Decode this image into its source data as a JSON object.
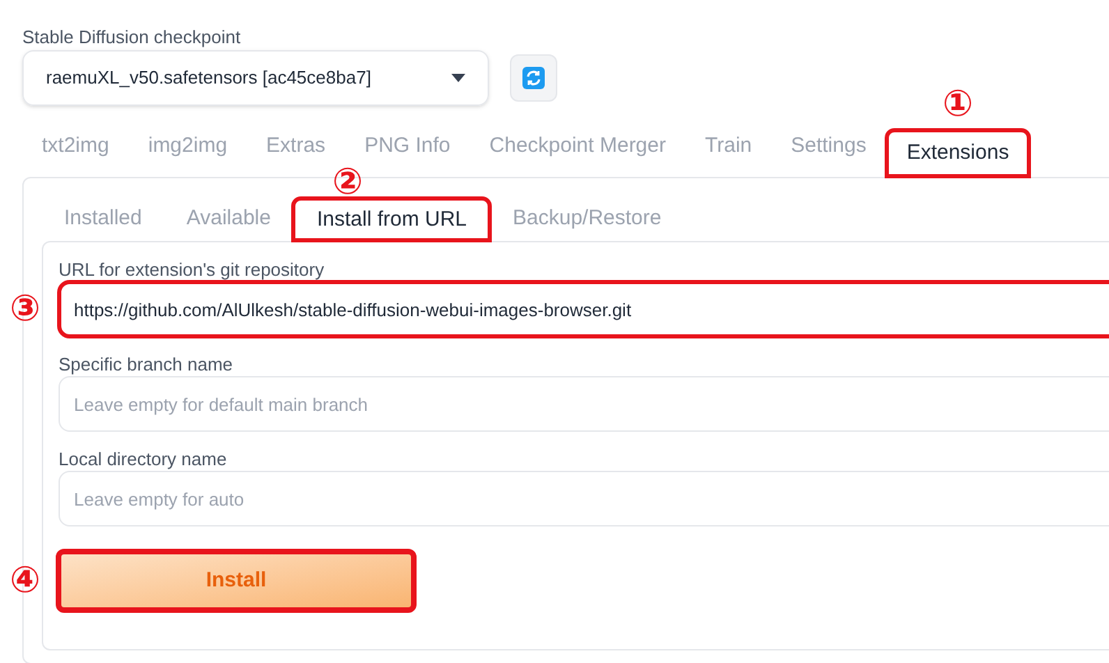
{
  "checkpoint": {
    "label": "Stable Diffusion checkpoint",
    "value": "raemuXL_v50.safetensors [ac45ce8ba7]"
  },
  "tabs": [
    {
      "label": "txt2img",
      "selected": false,
      "highlighted": false
    },
    {
      "label": "img2img",
      "selected": false,
      "highlighted": false
    },
    {
      "label": "Extras",
      "selected": false,
      "highlighted": false
    },
    {
      "label": "PNG Info",
      "selected": false,
      "highlighted": false
    },
    {
      "label": "Checkpoint Merger",
      "selected": false,
      "highlighted": false
    },
    {
      "label": "Train",
      "selected": false,
      "highlighted": false
    },
    {
      "label": "Settings",
      "selected": false,
      "highlighted": false
    },
    {
      "label": "Extensions",
      "selected": true,
      "highlighted": true,
      "marker": "①"
    }
  ],
  "subtabs": [
    {
      "label": "Installed",
      "selected": false,
      "highlighted": false
    },
    {
      "label": "Available",
      "selected": false,
      "highlighted": false
    },
    {
      "label": "Install from URL",
      "selected": true,
      "highlighted": true,
      "marker": "②"
    },
    {
      "label": "Backup/Restore",
      "selected": false,
      "highlighted": false
    }
  ],
  "fields": [
    {
      "label": "URL for extension's git repository",
      "value": "https://github.com/AlUlkesh/stable-diffusion-webui-images-browser.git",
      "highlighted": true,
      "marker": "③"
    },
    {
      "label": "Specific branch name",
      "placeholder": "Leave empty for default main branch",
      "highlighted": false
    },
    {
      "label": "Local directory name",
      "placeholder": "Leave empty for auto",
      "highlighted": false
    }
  ],
  "install_button": {
    "label": "Install",
    "highlighted": true,
    "marker": "④"
  }
}
